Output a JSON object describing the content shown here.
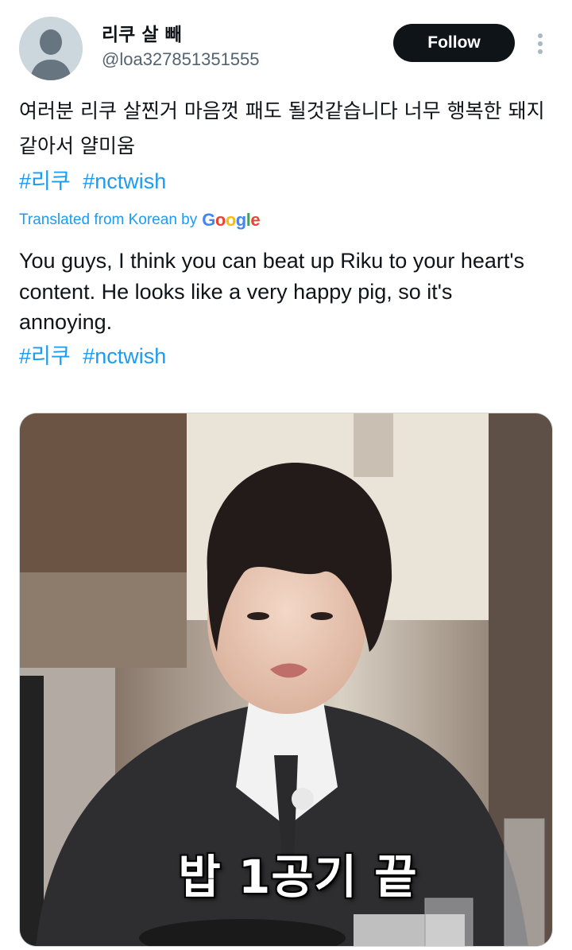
{
  "author": {
    "display_name": "리쿠 살 빼",
    "handle": "@loa327851351555",
    "avatar_icon": "default-avatar-icon"
  },
  "follow_label": "Follow",
  "more_icon": "more-vertical-icon",
  "tweet": {
    "text": "여러분 리쿠 살찐거 마음껏 패도 될것같습니다 너무 행복한 돼지같아서 얄미움",
    "hashtags": [
      "#리쿠",
      "#nctwish"
    ]
  },
  "translation": {
    "label": "Translated from Korean by",
    "provider": "Google",
    "text": "You guys, I think you can beat up Riku to your heart's content. He looks like a very happy pig, so it's annoying.",
    "hashtags": [
      "#리쿠",
      "#nctwish"
    ]
  },
  "media": {
    "caption": "밥 1공기 끝"
  },
  "colors": {
    "link": "#1d9bf0",
    "text": "#0f1419",
    "secondary": "#536471",
    "button": "#0f1419"
  }
}
